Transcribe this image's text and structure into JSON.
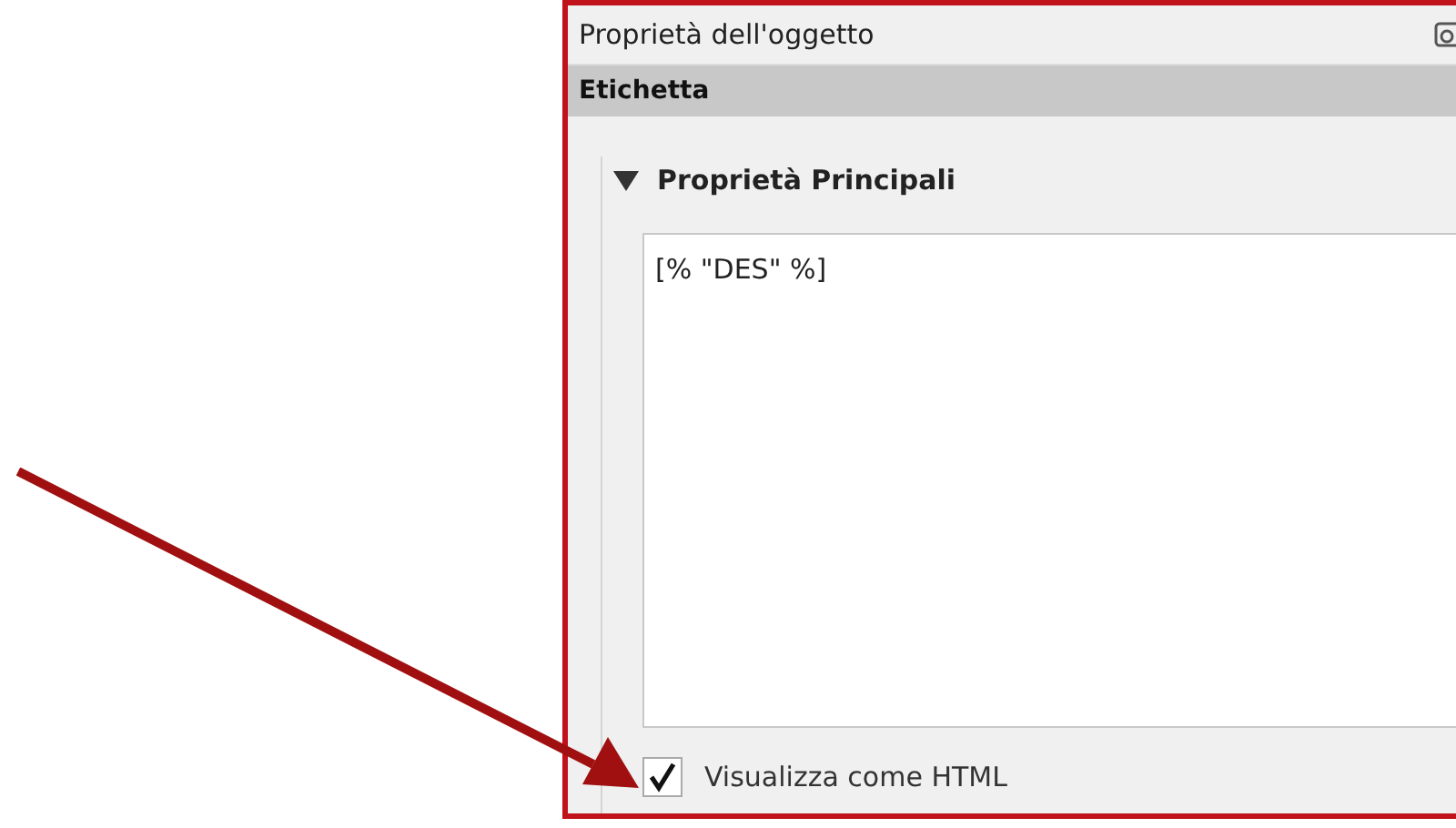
{
  "panel": {
    "title": "Proprietà dell'oggetto"
  },
  "section": {
    "title": "Etichetta"
  },
  "group": {
    "title": "Proprietà Principali",
    "expanded": true
  },
  "expression": {
    "value": "[% \"DES\" %]"
  },
  "checkbox": {
    "label": "Visualizza come HTML",
    "checked": true
  }
}
